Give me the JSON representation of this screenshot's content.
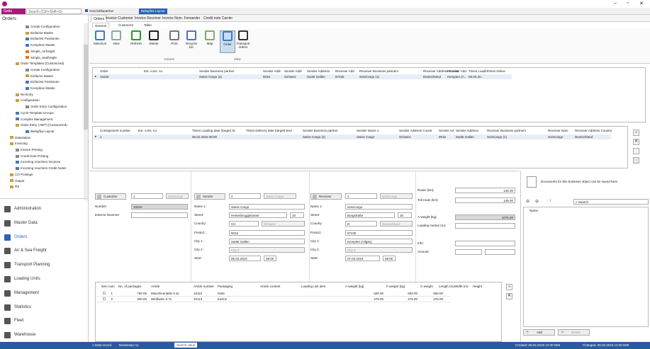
{
  "window": {
    "title_tab": "Gatia",
    "search": "Search (Ctrl+Shift+G)",
    "partner_tab": "Geschäftspartner",
    "layout_tab": "Beleg/fax Layout"
  },
  "left": {
    "header": "Orders",
    "tree": [
      "Create Configuration",
      "Einfache Maske",
      "Einfachst Positionen",
      "Komplexe Maske",
      "Simple_Airfreight",
      "Simple_Seafreight",
      "Order Templates (Customized)",
      "Create Configuration",
      "Einfache Maske",
      "Einfachst Positionen",
      "Komplexe Maske",
      "Re-Entry",
      "Configuration",
      "Order Entry Configuration",
      "Cycle Template Groups",
      "Complex Management",
      "Order Entry (.NET) (Customized)",
      "Beleg/fax Layout",
      "Datasiation",
      "Invoicing",
      "Invoice Printing",
      "Credit Note Printing",
      "Incoming Vouchers Invoices",
      "Incoming Vouchers Credit Notes",
      "CO Postings",
      "Output",
      "RS"
    ],
    "nav": [
      "Administration",
      "Master Data",
      "Orders",
      "Air & Sea Freight",
      "Transport Planning",
      "Loading Units",
      "Management",
      "Statistics",
      "Fleet",
      "Warehouse"
    ]
  },
  "tabs": [
    "Orders",
    "Invoice Customer",
    "Invoice Receiver",
    "Invoice Num. Forwarder",
    "Credit note Carrier"
  ],
  "ribbon_tabs": [
    "General",
    "Customize",
    "Table"
  ],
  "ribbon": {
    "buttons": [
      "Selection",
      "New",
      "Refresh",
      "Delete",
      "Print",
      "Recycle bin",
      "Map",
      "Order",
      "Transport orders"
    ],
    "groups": [
      "Actions",
      "View"
    ]
  },
  "orders_grid": {
    "headers": [
      "Order",
      "Ext. cons. no.",
      "Sender Business partner",
      "Sender Addr",
      "Sender Addr",
      "Sender Address",
      "Receiver Add",
      "Receiver Business partners",
      "Receiver Address Countr",
      "Receiver Add",
      "Times Loadin",
      "Times Delive"
    ],
    "row": [
      "10220",
      "",
      "Swiss Cargo (2)",
      "9016",
      "Schweiz",
      "Sankt Gallen",
      "87435",
      "SoloCargo (1)",
      "Deutschland",
      "Kempten (A...",
      "06.02.20...",
      ""
    ]
  },
  "cons_grid": {
    "headers": [
      "Consignment number",
      "Ext. cons. no.",
      "Times Loading date (target) St",
      "Times Delivery date (target) End",
      "Sender Business partner",
      "Sender Name 1",
      "Sender Address Countr",
      "Sender Ad",
      "Sender Address",
      "Receiver Business partners",
      "Receiver Nam",
      "Receiver Address Country"
    ],
    "row": [
      "1",
      "",
      "06.02.2019 08:00",
      "",
      "Swiss Cargo (2)",
      "Swiss Cargo",
      "Schweiz",
      "9016",
      "Sankt Gallen",
      "SoloCargo (1)",
      "SoloCargo",
      "Deutschland"
    ]
  },
  "customer": {
    "role": "Customer",
    "no": "1",
    "name": "SoloCargo",
    "number_label": "Number:",
    "number": "10220",
    "ext_label": "Externe Nummer:"
  },
  "sender": {
    "role": "Sender",
    "no": "2",
    "name": "Swiss Cargo",
    "name1_label": "Name 1:",
    "name1": "Swiss Cargo",
    "street_label": "Street:",
    "street": "Hertenbruggstrasse",
    "street_no": "10",
    "country_label": "Country:",
    "country": "CH",
    "country_name": "Schweiz",
    "postcd_label": "Postcd.:",
    "postcd": "9016",
    "city1_label": "City 1:",
    "city1": "Sankt Gallen",
    "city2_label": "City 2:",
    "city2": "City 2",
    "start_label": "Start:",
    "date": "06.02.2019",
    "time": "08:00"
  },
  "receiver": {
    "role": "Receiver",
    "no": "1",
    "name": "SoloCargo",
    "name1_label": "Name 1:",
    "name1": "SoloCargo",
    "street_label": "Street:",
    "street": "Burgstraße",
    "street_no": "10",
    "country_label": "Country:",
    "country": "D",
    "country_name": "Deutschland",
    "postcd_label": "Postcd.:",
    "postcd": "87435",
    "city1_label": "City 1:",
    "city1": "Kempten (Allgäu)",
    "city2_label": "City 2:",
    "city2": "City 2",
    "start_label": "Start:",
    "date": "07.02.2019",
    "time": "08:00"
  },
  "route": {
    "route_label": "Route (km):",
    "route": "145.00",
    "toll_label": "Toll route (km):",
    "toll": "145.00",
    "aweight_label": "A-weight (kg):",
    "aweight": "1075.00",
    "ldm_label": "Loading metres (m):",
    "info_label": "Info:",
    "amount_label": "Amount:"
  },
  "docs": {
    "text": "Documents for this business object can be saved here.",
    "search": "Search",
    "col": "Name",
    "add": "Add",
    "delete": "Delete"
  },
  "positions": {
    "headers": [
      "Item num",
      "No. of packages",
      "Article",
      "Article number",
      "Packaging",
      "Article content",
      "Loading unit item",
      "A-weight (kg)",
      "F-weight (kg)",
      "C-weight",
      "Length (m)",
      "Width (m)",
      "Height"
    ],
    "rows": [
      [
        "1",
        "750.00",
        "Maschinenteile 0.3L",
        "10110",
        "Kiste",
        "",
        "",
        "600.00",
        "600.00",
        "600.00"
      ],
      [
        "2",
        "300.00",
        "Weißwein 0.7L",
        "10113",
        "Karton",
        "",
        "",
        "475.00",
        "475.00",
        "475.00"
      ]
    ]
  },
  "status": {
    "records": "1 Data record",
    "bordereau": "Bordereau no.",
    "search": "Search value",
    "created": "Created: 06.02.2019 12:30 DMI",
    "changed": "Changed: 06.02.2019 12:30 DMI"
  }
}
